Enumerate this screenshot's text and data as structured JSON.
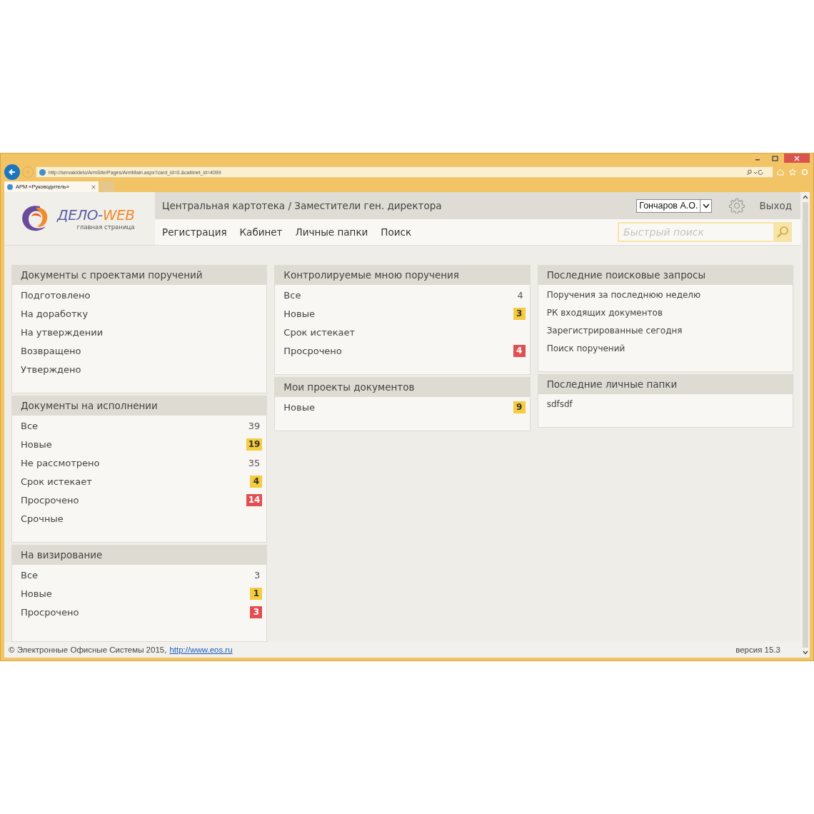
{
  "browser": {
    "url": "http://servak/delo/ArmSite/Pages/ArmMain.aspx?card_id=0.&cabinet_id=4099",
    "tab_title": "АРМ «Руководитель»"
  },
  "header": {
    "logo": {
      "prefix": "ДЕЛО-",
      "suffix": "WEB",
      "subtitle": "главная страница"
    },
    "breadcrumb": "Центральная картотека / Заместители ген. директора",
    "user": "Гончаров А.О.",
    "logout": "Выход",
    "nav": [
      "Регистрация",
      "Кабинет",
      "Личные папки",
      "Поиск"
    ],
    "search": {
      "placeholder": "Быстрый поиск"
    }
  },
  "columns": [
    {
      "panels": [
        {
          "title": "Документы с проектами поручений",
          "items": [
            {
              "label": "Подготовлено",
              "kind": "none"
            },
            {
              "label": "На доработку",
              "kind": "none"
            },
            {
              "label": "На утверждении",
              "kind": "none"
            },
            {
              "label": "Возвращено",
              "kind": "none"
            },
            {
              "label": "Утверждено",
              "kind": "none"
            }
          ]
        },
        {
          "title": "Документы на исполнении",
          "items": [
            {
              "label": "Все",
              "kind": "plain",
              "count": "39"
            },
            {
              "label": "Новые",
              "kind": "new",
              "count": "19"
            },
            {
              "label": "Не рассмотрено",
              "kind": "plain",
              "count": "35"
            },
            {
              "label": "Срок истекает",
              "kind": "new",
              "count": "4"
            },
            {
              "label": "Просрочено",
              "kind": "overdue",
              "count": "14"
            },
            {
              "label": "Срочные",
              "kind": "none"
            }
          ]
        },
        {
          "title": "На визирование",
          "items": [
            {
              "label": "Все",
              "kind": "plain",
              "count": "3"
            },
            {
              "label": "Новые",
              "kind": "new",
              "count": "1"
            },
            {
              "label": "Просрочено",
              "kind": "overdue",
              "count": "3"
            }
          ]
        }
      ]
    },
    {
      "panels": [
        {
          "title": "Контролируемые мною поручения",
          "items": [
            {
              "label": "Все",
              "kind": "plain",
              "count": "4"
            },
            {
              "label": "Новые",
              "kind": "new",
              "count": "3"
            },
            {
              "label": "Срок истекает",
              "kind": "none"
            },
            {
              "label": "Просрочено",
              "kind": "overdue",
              "count": "4"
            }
          ]
        },
        {
          "title": "Мои проекты документов",
          "items": [
            {
              "label": "Новые",
              "kind": "new",
              "count": "9"
            }
          ]
        }
      ]
    },
    {
      "panels": [
        {
          "title": "Последние поисковые запросы",
          "items": [
            {
              "label": "Поручения за последнюю неделю",
              "kind": "none"
            },
            {
              "label": "РК входящих документов",
              "kind": "none"
            },
            {
              "label": "Зарегистрированные сегодня",
              "kind": "none"
            },
            {
              "label": "Поиск поручений",
              "kind": "none"
            }
          ]
        },
        {
          "title": "Последние личные папки",
          "items": [
            {
              "label": "sdfsdf",
              "kind": "none"
            }
          ]
        }
      ]
    }
  ],
  "footer": {
    "copyright": "© Электронные Офисные Системы 2015,",
    "link": "http://www.eos.ru",
    "version": "версия 15.3"
  }
}
